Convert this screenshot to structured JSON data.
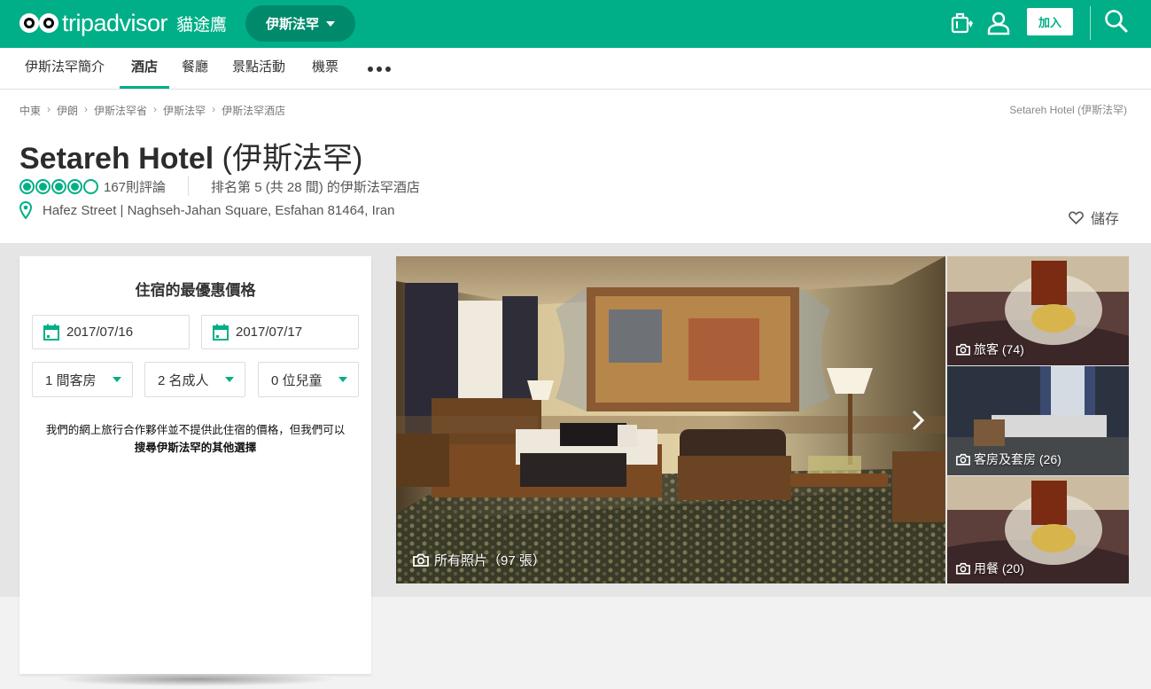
{
  "topbar": {
    "logo_text": "tripadvisor",
    "logo_sub": "貓途鷹",
    "geo_label": "伊斯法罕",
    "join_label": "加入",
    "icons": [
      "trips-icon",
      "user-icon",
      "search-icon"
    ]
  },
  "nav": {
    "items": [
      {
        "label": "伊斯法罕簡介"
      },
      {
        "label": "酒店"
      },
      {
        "label": "餐廳"
      },
      {
        "label": "景點活動"
      },
      {
        "label": "機票"
      }
    ],
    "active_index": 1
  },
  "breadcrumb": {
    "items": [
      "中東",
      "伊朗",
      "伊斯法罕省",
      "伊斯法罕",
      "伊斯法罕酒店"
    ],
    "current": "Setareh Hotel (伊斯法罕)"
  },
  "hotel": {
    "name": "Setareh Hotel",
    "name_zh": "(伊斯法罕)",
    "rating_bubbles": 4,
    "rating_max": 5,
    "reviews": "167則評論",
    "rank": "排名第 5 (共 28 間) 的伊斯法罕酒店",
    "address": "Hafez Street | Naghseh-Jahan Square, Esfahan 81464, Iran",
    "save_label": "儲存"
  },
  "booking": {
    "title": "住宿的最優惠價格",
    "checkin": "2017/07/16",
    "checkout": "2017/07/17",
    "rooms": "1 間客房",
    "adults": "2 名成人",
    "children": "0 位兒童",
    "note": "我們的網上旅行合作夥伴並不提供此住宿的價格，但我們可以",
    "note_link": "搜尋伊斯法罕的其他選擇"
  },
  "photos": {
    "main_label": "所有照片（97 張）",
    "side": [
      {
        "label": "旅客 (74)"
      },
      {
        "label": "客房及套房 (26)"
      },
      {
        "label": "用餐 (20)"
      }
    ]
  },
  "colors": {
    "brand": "#00af87",
    "brand_dark": "#008a6b"
  }
}
